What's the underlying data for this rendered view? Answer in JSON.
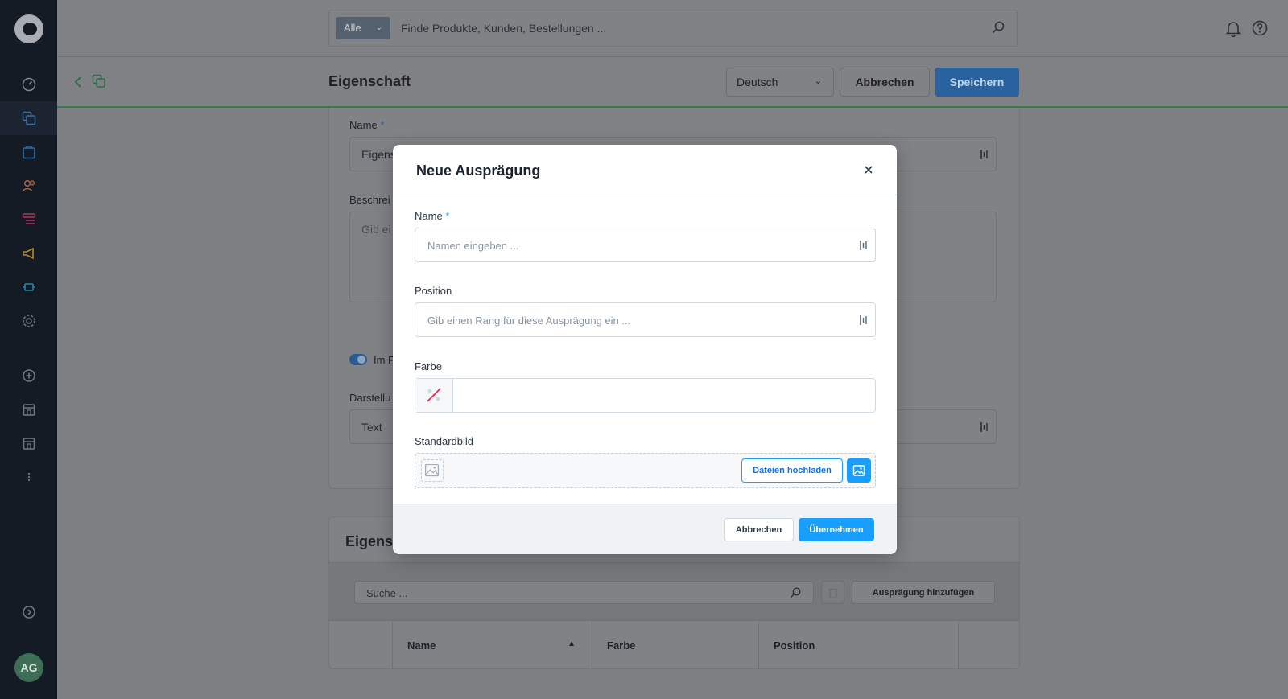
{
  "topbar": {
    "search_scope": "Alle",
    "search_placeholder": "Finde Produkte, Kunden, Bestellungen ..."
  },
  "smartbar": {
    "title": "Eigenschaft",
    "language": "Deutsch",
    "cancel_label": "Abbrechen",
    "save_label": "Speichern"
  },
  "sidebar": {
    "items": [
      {
        "icon": "dashboard-icon"
      },
      {
        "icon": "catalog-icon",
        "active": true
      },
      {
        "icon": "orders-icon"
      },
      {
        "icon": "customers-icon"
      },
      {
        "icon": "content-icon"
      },
      {
        "icon": "marketing-icon"
      },
      {
        "icon": "extensions-icon"
      },
      {
        "icon": "settings-icon"
      },
      {
        "icon": "add-sales-channel-icon"
      },
      {
        "icon": "sales-channel-icon"
      },
      {
        "icon": "sales-channel-icon"
      },
      {
        "icon": "more-icon"
      },
      {
        "icon": "collapse-icon"
      }
    ],
    "avatar_initials": "AG"
  },
  "card": {
    "name_label": "Name",
    "name_required": "*",
    "name_value": "Eigens",
    "description_label": "Beschrei",
    "description_placeholder": "Gib ei",
    "toggle_label": "Im P",
    "display_label": "Darstellu",
    "display_value": "Text"
  },
  "card2": {
    "title": "Eigensch",
    "search_placeholder": "Suche ...",
    "add_button": "Ausprägung hinzufügen",
    "columns": [
      "Name",
      "Farbe",
      "Position"
    ]
  },
  "modal": {
    "title": "Neue Ausprägung",
    "name_label": "Name",
    "name_required": "*",
    "name_placeholder": "Namen eingeben ...",
    "position_label": "Position",
    "position_placeholder": "Gib einen Rang für diese Ausprägung ein ...",
    "color_label": "Farbe",
    "image_label": "Standardbild",
    "upload_button": "Dateien hochladen",
    "cancel_button": "Abbrechen",
    "apply_button": "Übernehmen"
  },
  "colors": {
    "primary": "#189eff",
    "sidebar_bg": "#141b25",
    "success_line": "#37d046"
  }
}
